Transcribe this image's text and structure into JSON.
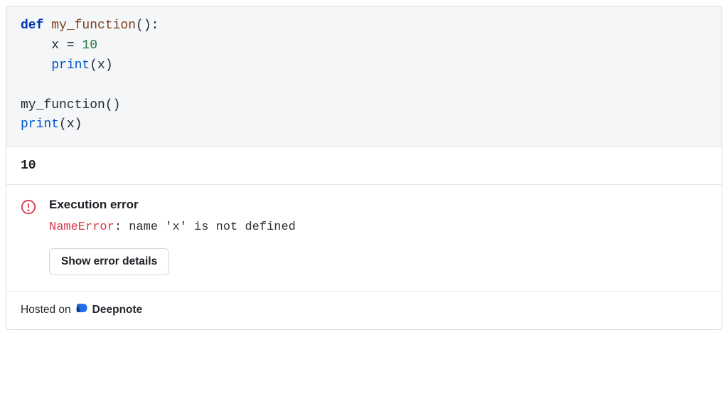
{
  "code": {
    "lines": [
      {
        "segments": [
          {
            "cls": "tok-kw",
            "t": "def"
          },
          {
            "cls": "",
            "t": " "
          },
          {
            "cls": "tok-fn",
            "t": "my_function"
          },
          {
            "cls": "",
            "t": "():"
          }
        ]
      },
      {
        "segments": [
          {
            "cls": "",
            "t": "    x = "
          },
          {
            "cls": "tok-num",
            "t": "10"
          }
        ]
      },
      {
        "segments": [
          {
            "cls": "",
            "t": "    "
          },
          {
            "cls": "tok-builtin",
            "t": "print"
          },
          {
            "cls": "",
            "t": "(x)"
          }
        ]
      },
      {
        "segments": [
          {
            "cls": "",
            "t": ""
          }
        ]
      },
      {
        "segments": [
          {
            "cls": "tok-var",
            "t": "my_function()"
          }
        ]
      },
      {
        "segments": [
          {
            "cls": "tok-builtin",
            "t": "print"
          },
          {
            "cls": "",
            "t": "(x)"
          }
        ]
      }
    ]
  },
  "output": {
    "stdout": "10"
  },
  "error": {
    "title": "Execution error",
    "type": "NameError",
    "sep": ": ",
    "message": "name 'x' is not defined",
    "button_label": "Show error details"
  },
  "footer": {
    "prefix": "Hosted on",
    "brand": "Deepnote"
  }
}
